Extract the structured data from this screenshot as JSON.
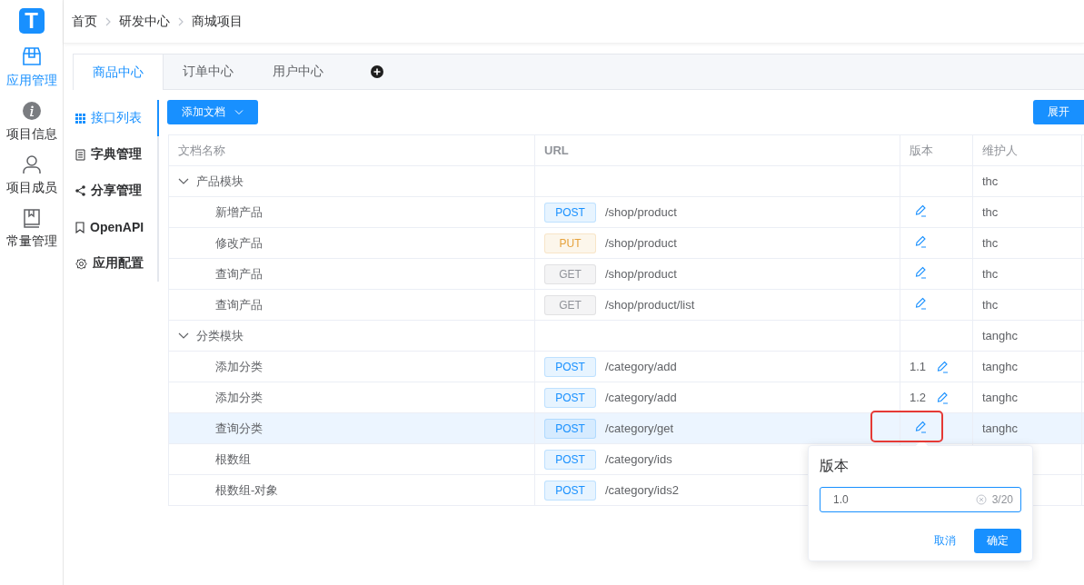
{
  "rail": {
    "logo": "T",
    "items": [
      {
        "label": "应用管理",
        "selected": true
      },
      {
        "label": "项目信息",
        "selected": false
      },
      {
        "label": "项目成员",
        "selected": false
      },
      {
        "label": "常量管理",
        "selected": false
      }
    ]
  },
  "breadcrumb": [
    "首页",
    "研发中心",
    "商城项目"
  ],
  "tabs": [
    {
      "label": "商品中心",
      "selected": true
    },
    {
      "label": "订单中心",
      "selected": false
    },
    {
      "label": "用户中心",
      "selected": false
    }
  ],
  "side_menu": [
    {
      "label": "接口列表",
      "selected": true
    },
    {
      "label": "字典管理",
      "selected": false
    },
    {
      "label": "分享管理",
      "selected": false
    },
    {
      "label": "OpenAPI",
      "selected": false
    },
    {
      "label": "应用配置",
      "selected": false
    }
  ],
  "toolbar": {
    "add_button": "添加文档",
    "expand_button": "展开"
  },
  "table": {
    "columns": [
      "文档名称",
      "URL",
      "版本",
      "维护人"
    ],
    "rows": [
      {
        "kind": "group",
        "name": "产品模块",
        "expanded": true,
        "maintainer": "thc",
        "selected": false
      },
      {
        "kind": "doc",
        "name": "新增产品",
        "method": "POST",
        "color": "#1890ff",
        "url": "/shop/product",
        "maintainer": "thc",
        "selected": false,
        "outlined": false
      },
      {
        "kind": "doc",
        "name": "修改产品",
        "method": "PUT",
        "color": "#e6a23c",
        "url": "/shop/product",
        "maintainer": "thc",
        "selected": false,
        "outlined": false
      },
      {
        "kind": "doc",
        "name": "查询产品",
        "method": "GET",
        "color": "#909399",
        "url": "/shop/product",
        "maintainer": "thc",
        "selected": false,
        "outlined": false
      },
      {
        "kind": "doc",
        "name": "查询产品",
        "method": "GET",
        "color": "#909399",
        "url": "/shop/product/list",
        "maintainer": "thc",
        "selected": false,
        "outlined": false
      },
      {
        "kind": "group",
        "name": "分类模块",
        "expanded": true,
        "maintainer": "tanghc",
        "selected": false
      },
      {
        "kind": "doc",
        "name": "添加分类",
        "method": "POST",
        "color": "#1890ff",
        "url": "/category/add",
        "version": "1.1",
        "maintainer": "tanghc",
        "selected": false,
        "outlined": false
      },
      {
        "kind": "doc",
        "name": "添加分类",
        "method": "POST",
        "color": "#1890ff",
        "url": "/category/add",
        "version": "1.2",
        "maintainer": "tanghc",
        "selected": false,
        "outlined": false
      },
      {
        "kind": "doc",
        "name": "查询分类",
        "method": "POST",
        "color": "#1890ff",
        "url": "/category/get",
        "maintainer": "tanghc",
        "selected": true,
        "outlined": true
      },
      {
        "kind": "doc",
        "name": "根数组",
        "method": "POST",
        "color": "#1890ff",
        "url": "/category/ids",
        "selected": false,
        "outlined": false
      },
      {
        "kind": "doc",
        "name": "根数组-对象",
        "method": "POST",
        "color": "#1890ff",
        "url": "/category/ids2",
        "selected": false,
        "outlined": false
      }
    ]
  },
  "popover": {
    "title": "版本",
    "value": "1.0",
    "counter": "3/20",
    "cancel_button": "取消",
    "confirm_button": "确定"
  }
}
